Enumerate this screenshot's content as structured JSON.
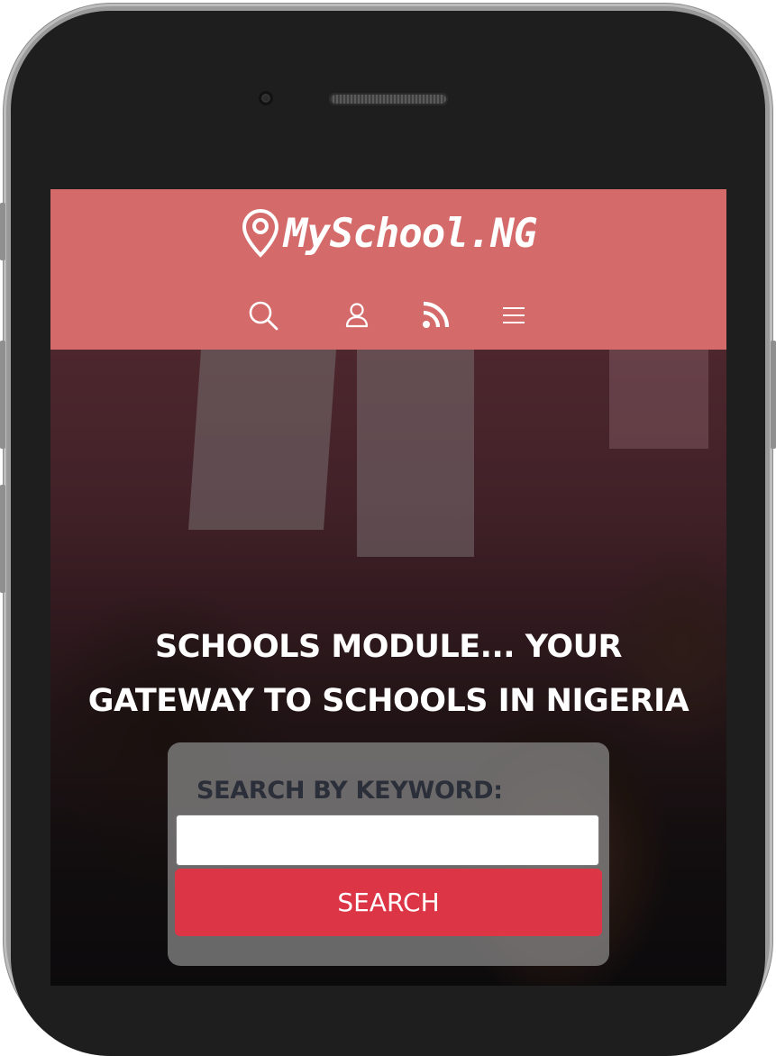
{
  "header": {
    "brand": "MySchool.NG",
    "brand_icon": "map-pin-icon",
    "background_color": "#d46b6a",
    "nav_icons": [
      "search-icon",
      "user-icon",
      "rss-icon",
      "menu-icon"
    ]
  },
  "hero": {
    "title_line1": "SCHOOLS MODULE... YOUR",
    "title_line2": "GATEWAY TO SCHOOLS IN NIGERIA"
  },
  "search": {
    "label": "SEARCH BY KEYWORD:",
    "input_value": "",
    "button_label": "SEARCH",
    "button_color": "#dc3545"
  }
}
